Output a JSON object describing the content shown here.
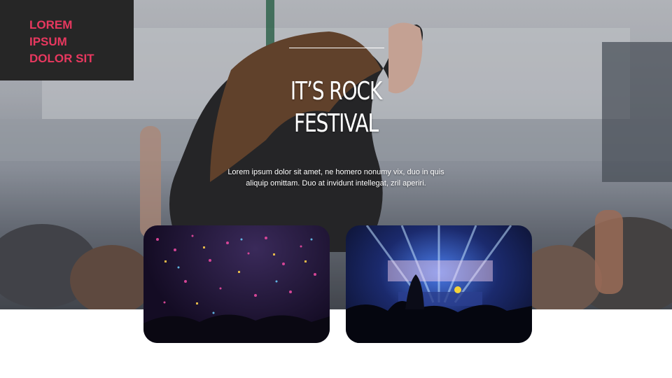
{
  "brand": {
    "lines": [
      "LOREM",
      "IPSUM",
      "DOLOR SIT"
    ],
    "color": "#e8385f",
    "box_color": "#262626"
  },
  "hero": {
    "title_lines": [
      "IT’S ROCK",
      "FESTIVAL"
    ],
    "body_lines": [
      "Lorem  ipsum dolor sit amet, ne homero nonumy vix, duo in quis",
      "aliquip omittam. Duo at invidunt intellegat, zril aperiri."
    ]
  },
  "photos": [
    {
      "label": "confetti-crowd-photo"
    },
    {
      "label": "concert-stage-photo"
    }
  ]
}
